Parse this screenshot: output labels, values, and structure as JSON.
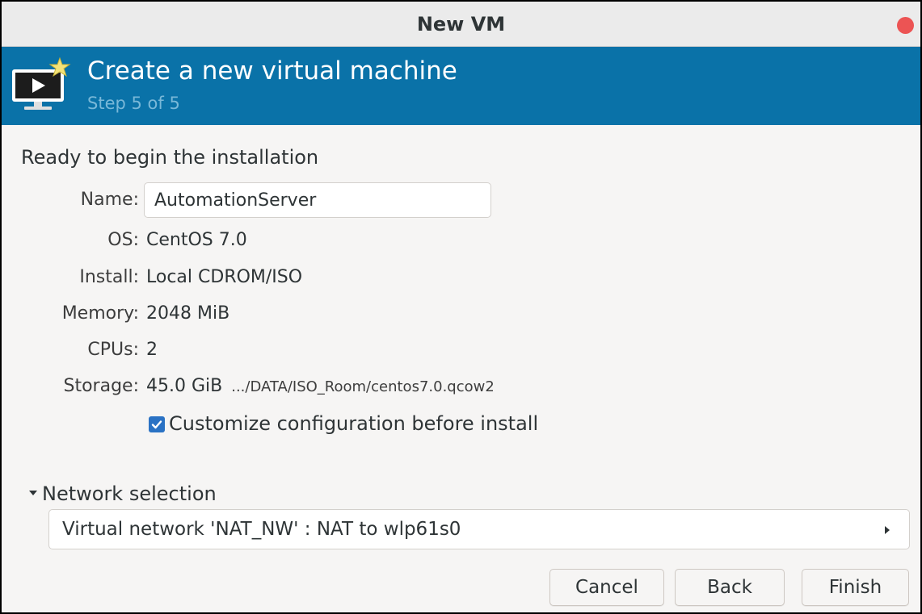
{
  "window": {
    "title": "New VM"
  },
  "banner": {
    "heading": "Create a new virtual machine",
    "step": "Step 5 of 5"
  },
  "summary": {
    "intro": "Ready to begin the installation",
    "name_label": "Name:",
    "name_value": "AutomationServer",
    "os_label": "OS:",
    "os_value": "CentOS 7.0",
    "install_label": "Install:",
    "install_value": "Local CDROM/ISO",
    "memory_label": "Memory:",
    "memory_value": "2048 MiB",
    "cpus_label": "CPUs:",
    "cpus_value": "2",
    "storage_label": "Storage:",
    "storage_size": "45.0 GiB",
    "storage_path": ".../DATA/ISO_Room/centos7.0.qcow2"
  },
  "customize": {
    "label": "Customize configuration before install",
    "checked": true
  },
  "network": {
    "section_label": "Network selection",
    "expanded": true,
    "selected": "Virtual network 'NAT_NW' : NAT to wlp61s0"
  },
  "buttons": {
    "cancel": "Cancel",
    "back": "Back",
    "finish": "Finish"
  },
  "colors": {
    "banner": "#0a72a8",
    "close": "#ec5454",
    "checkbox": "#2a72c4"
  }
}
